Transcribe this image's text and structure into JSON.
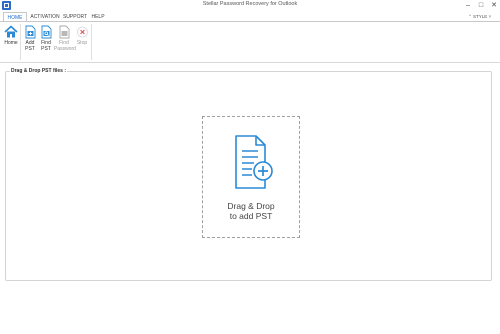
{
  "window": {
    "title": "Stellar Password Recovery for Outlook"
  },
  "tabs": [
    {
      "label": "HOME",
      "active": true
    },
    {
      "label": "ACTIVATION",
      "active": false
    },
    {
      "label": "SUPPORT",
      "active": false
    },
    {
      "label": "HELP",
      "active": false
    }
  ],
  "style_menu": "⌃ STYLE ˅",
  "ribbon": {
    "home": {
      "label": "Home",
      "icon": "house-icon"
    },
    "add_pst": {
      "line1": "Add",
      "line2": "PST",
      "icon": "add-file-icon"
    },
    "find_pst": {
      "line1": "Find",
      "line2": "PST",
      "icon": "find-file-icon"
    },
    "find_password": {
      "line1": "Find",
      "line2": "Password",
      "icon": "key-file-icon",
      "enabled": false
    },
    "stop": {
      "label": "Stop",
      "icon": "stop-icon",
      "enabled": false
    }
  },
  "panel": {
    "legend": "Drag & Drop PST files :",
    "drop_line1": "Drag & Drop",
    "drop_line2": "to add PST",
    "icon": "file-add-icon"
  },
  "colors": {
    "accent": "#1e6fc9",
    "icon_blue": "#2a8ad6",
    "stop_red": "#e05050"
  }
}
